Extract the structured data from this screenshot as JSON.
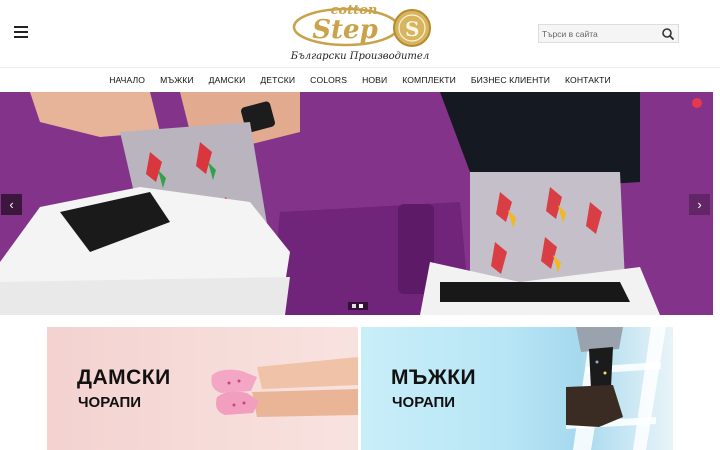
{
  "header": {
    "logo": {
      "word_top": "cotton",
      "word_main": "Step",
      "tagline": "Български Производител"
    },
    "search": {
      "placeholder": "Търси в сайта",
      "button_icon": "search-icon"
    },
    "menu_icon": "hamburger-menu-icon"
  },
  "nav": {
    "items": [
      {
        "label": "НАЧАЛО"
      },
      {
        "label": "МЪЖКИ"
      },
      {
        "label": "ДАМСКИ"
      },
      {
        "label": "ДЕТСКИ"
      },
      {
        "label": "COLORS"
      },
      {
        "label": "НОВИ"
      },
      {
        "label": "КОМПЛЕКТИ"
      },
      {
        "label": "БИЗНЕС КЛИЕНТИ"
      },
      {
        "label": "КОНТАКТИ"
      }
    ]
  },
  "slider": {
    "prev_icon": "chevron-left-icon",
    "next_icon": "chevron-right-icon",
    "prev_glyph": "‹",
    "next_glyph": "›"
  },
  "banners": [
    {
      "title": "ДАМСКИ",
      "subtitle": "ЧОРАПИ"
    },
    {
      "title": "МЪЖКИ",
      "subtitle": "ЧОРАПИ"
    }
  ],
  "colors": {
    "gold": "#c9a24a",
    "slider_purple": "#7f3282",
    "nav_text": "#111111"
  }
}
